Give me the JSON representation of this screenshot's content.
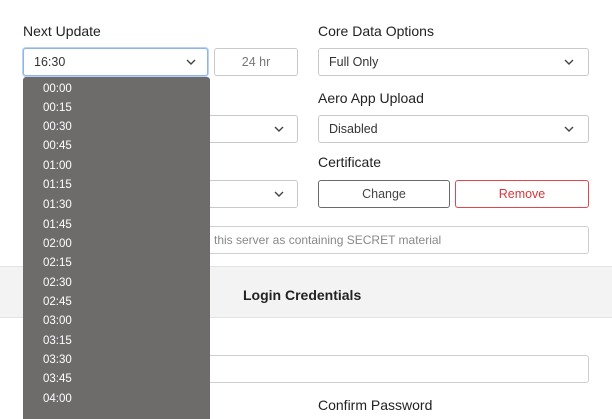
{
  "next_update": {
    "label": "Next Update",
    "value": "16:30",
    "hr_button": "24 hr",
    "options": [
      "00:00",
      "00:15",
      "00:30",
      "00:45",
      "01:00",
      "01:15",
      "01:30",
      "01:45",
      "02:00",
      "02:15",
      "02:30",
      "02:45",
      "03:00",
      "03:15",
      "03:30",
      "03:45",
      "04:00"
    ]
  },
  "core_data": {
    "label": "Core Data Options",
    "value": "Full Only"
  },
  "aero_upload": {
    "label": "Aero App Upload",
    "value": "Disabled"
  },
  "certificate": {
    "label": "Certificate",
    "change_button": "Change",
    "remove_button": "Remove"
  },
  "secret": {
    "text": "this server as containing SECRET material"
  },
  "login": {
    "section_title": "Login Credentials",
    "confirm_password_label": "Confirm Password"
  },
  "colors": {
    "dropdown_bg": "#6e6b6b",
    "remove_red": "#d8353b",
    "focus_blue": "#8fb4e8"
  }
}
